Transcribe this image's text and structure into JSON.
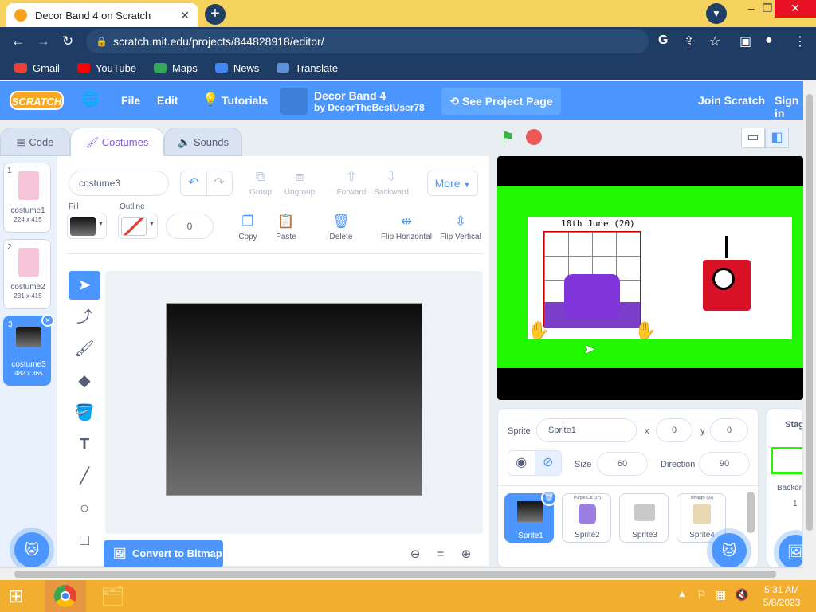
{
  "browser": {
    "tab_title": "Decor Band 4 on Scratch",
    "url": "scratch.mit.edu/projects/844828918/editor/",
    "bookmarks": [
      "Gmail",
      "YouTube",
      "Maps",
      "News",
      "Translate"
    ]
  },
  "menubar": {
    "logo": "SCRATCH",
    "file": "File",
    "edit": "Edit",
    "tutorials": "Tutorials",
    "project_title": "Decor Band 4",
    "project_by": "by DecorTheBestUser78",
    "see_project_page": "See Project Page",
    "join": "Join Scratch",
    "signin": "Sign in"
  },
  "tabs": {
    "code": "Code",
    "costumes": "Costumes",
    "sounds": "Sounds"
  },
  "costumes": [
    {
      "num": "1",
      "name": "costume1",
      "size": "224 x 415"
    },
    {
      "num": "2",
      "name": "costume2",
      "size": "231 x 415"
    },
    {
      "num": "3",
      "name": "costume3",
      "size": "482 x 365"
    }
  ],
  "editor": {
    "costume_name": "costume3",
    "group": "Group",
    "ungroup": "Ungroup",
    "forward": "Forward",
    "backward": "Backward",
    "more": "More",
    "fill_label": "Fill",
    "outline_label": "Outline",
    "outline_width": "0",
    "copy": "Copy",
    "paste": "Paste",
    "delete": "Delete",
    "flip_h": "Flip Horizontal",
    "flip_v": "Flip Vertical",
    "convert": "Convert to Bitmap",
    "zoom_reset": "="
  },
  "stage": {
    "banner_text": "10th June (20)"
  },
  "sprite_info": {
    "sprite_label": "Sprite",
    "sprite_name": "Sprite1",
    "x_label": "x",
    "x_value": "0",
    "y_label": "y",
    "y_value": "0",
    "size_label": "Size",
    "size_value": "60",
    "direction_label": "Direction",
    "direction_value": "90"
  },
  "sprites": [
    {
      "name": "Sprite1",
      "caption": ""
    },
    {
      "name": "Sprite2",
      "caption": "Purple Cat (37)"
    },
    {
      "name": "Sprite3",
      "caption": ""
    },
    {
      "name": "Sprite4",
      "caption": "Whappy (92)"
    }
  ],
  "stage_pane": {
    "title": "Stage",
    "backdrops": "Backdro",
    "count": "1"
  },
  "taskbar": {
    "time": "5:31 AM",
    "date": "5/8/2023"
  }
}
